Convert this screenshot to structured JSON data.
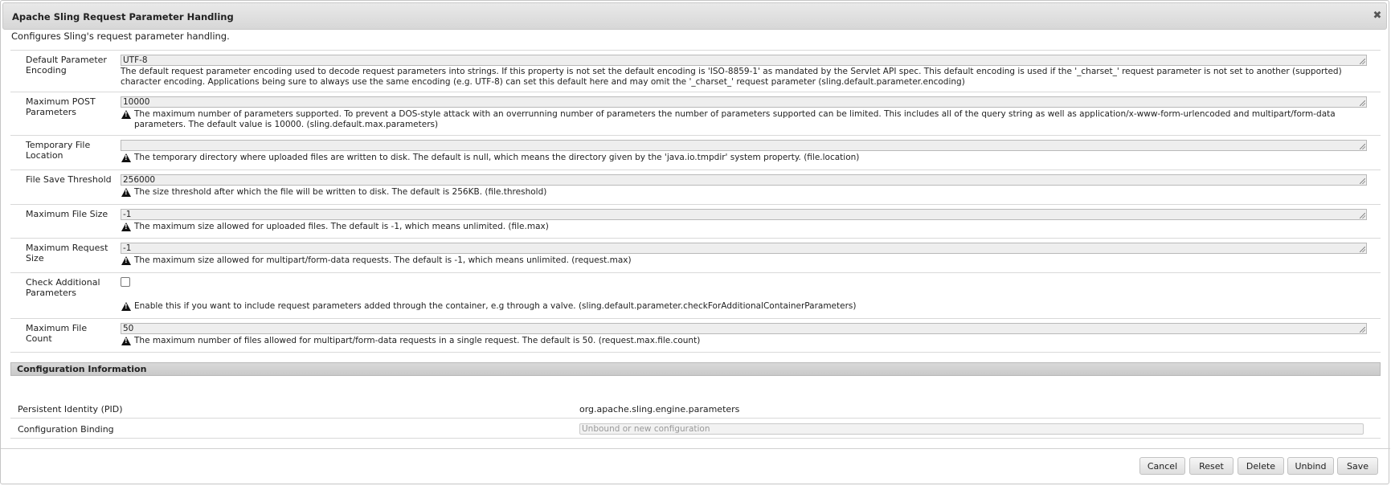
{
  "dialog": {
    "title": "Apache Sling Request Parameter Handling",
    "description": "Configures Sling's request parameter handling."
  },
  "properties": [
    {
      "label": "Default Parameter Encoding",
      "value": "UTF-8",
      "warning": false,
      "description": "The default request parameter encoding used to decode request parameters into strings. If this property is not set the default encoding is 'ISO-8859-1' as mandated by the Servlet API spec. This default encoding is used if the '_charset_' request parameter is not set to another (supported) character encoding. Applications being sure to always use the same encoding (e.g. UTF-8) can set this default here and may omit the '_charset_' request parameter (sling.default.parameter.encoding)"
    },
    {
      "label": "Maximum POST Parameters",
      "value": "10000",
      "warning": true,
      "description": "The maximum number of parameters supported. To prevent a DOS-style attack with an overrunning number of parameters the number of parameters supported can be limited. This includes all of the query string as well as application/x-www-form-urlencoded and multipart/form-data parameters. The default value is 10000. (sling.default.max.parameters)"
    },
    {
      "label": "Temporary File Location",
      "value": "",
      "warning": true,
      "description": "The temporary directory where uploaded files are written to disk. The default is null, which means the directory given by the 'java.io.tmpdir' system property. (file.location)"
    },
    {
      "label": "File Save Threshold",
      "value": "256000",
      "warning": true,
      "description": "The size threshold after which the file will be written to disk. The default is 256KB. (file.threshold)"
    },
    {
      "label": "Maximum File Size",
      "value": "-1",
      "warning": true,
      "description": "The maximum size allowed for uploaded files. The default is -1, which means unlimited. (file.max)"
    },
    {
      "label": "Maximum Request Size",
      "value": "-1",
      "warning": true,
      "description": "The maximum size allowed for multipart/form-data requests. The default is -1, which means unlimited. (request.max)"
    },
    {
      "label": "Check Additional Parameters",
      "type": "checkbox",
      "checked": false,
      "warning": true,
      "description": "Enable this if you want to include request parameters added through the container, e.g through a valve. (sling.default.parameter.checkForAdditionalContainerParameters)"
    },
    {
      "label": "Maximum File Count",
      "value": "50",
      "warning": true,
      "description": "The maximum number of files allowed for multipart/form-data requests in a single request. The default is 50. (request.max.file.count)"
    }
  ],
  "config_info": {
    "header": "Configuration Information",
    "pid_label": "Persistent Identity (PID)",
    "pid_value": "org.apache.sling.engine.parameters",
    "binding_label": "Configuration Binding",
    "binding_placeholder": "Unbound or new configuration"
  },
  "buttons": {
    "cancel": "Cancel",
    "reset": "Reset",
    "delete": "Delete",
    "unbind": "Unbind",
    "save": "Save"
  },
  "icons": {
    "close": "close-icon",
    "warning": "warning-icon"
  }
}
